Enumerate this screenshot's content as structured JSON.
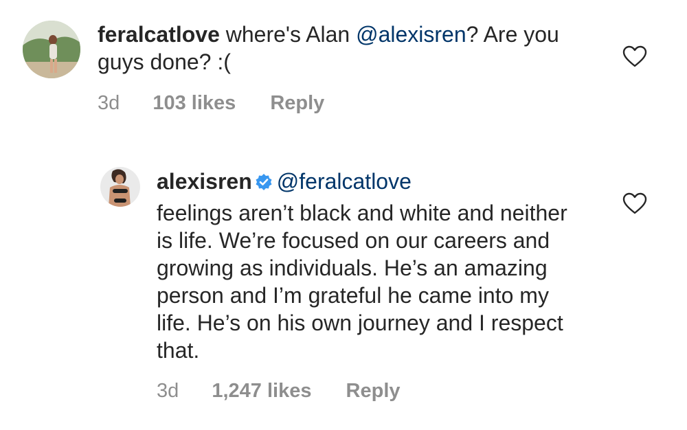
{
  "comments": [
    {
      "username": "feralcatlove",
      "text_before": " where's Alan ",
      "mention": "@alexisren",
      "text_after": "? Are you guys done? :(",
      "time": "3d",
      "likes": "103 likes",
      "reply_label": "Reply"
    },
    {
      "username": "alexisren",
      "mention": "@feralcatlove",
      "text": "feelings aren’t black and white and neither is life. We’re focused on our careers and growing as individuals. He’s an amazing person and I’m grateful he came into my life. He’s on his own journey and I respect that.",
      "time": "3d",
      "likes": "1,247 likes",
      "reply_label": "Reply"
    }
  ],
  "icons": {
    "like": "heart-outline-icon",
    "verified": "verified-badge-icon"
  },
  "colors": {
    "text": "#262626",
    "mention": "#003569",
    "meta": "#8e8e8e",
    "verified": "#3897f0",
    "heart_stroke": "#262626"
  }
}
